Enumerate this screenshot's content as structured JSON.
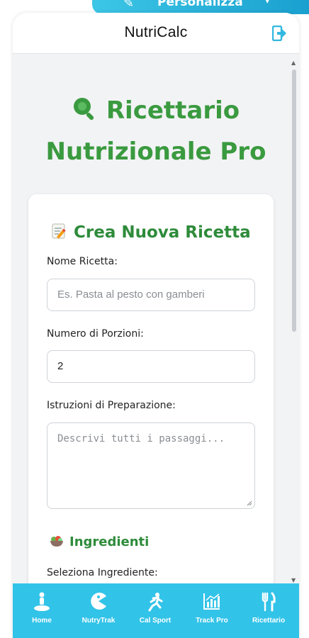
{
  "banner": {
    "label": "Personalizza"
  },
  "app": {
    "title": "NutriCalc"
  },
  "hero": {
    "line1": "Ricettario",
    "line2": "Nutrizionale Pro"
  },
  "form": {
    "title": "Crea Nuova Ricetta",
    "name_label": "Nome Ricetta:",
    "name_placeholder": "Es. Pasta al pesto con gamberi",
    "portions_label": "Numero di Porzioni:",
    "portions_value": "2",
    "instructions_label": "Istruzioni di Preparazione:",
    "instructions_placeholder": "Descrivi tutti i passaggi...",
    "ingredients_title": "Ingredienti",
    "select_label": "Seleziona Ingrediente:"
  },
  "nav": [
    {
      "label": "Home",
      "icon": "person-on-scale-icon"
    },
    {
      "label": "NutryTrak",
      "icon": "pacman-icon"
    },
    {
      "label": "Cal Sport",
      "icon": "runner-icon"
    },
    {
      "label": "Track Pro",
      "icon": "chart-icon"
    },
    {
      "label": "Ricettario",
      "icon": "utensils-icon"
    }
  ],
  "colors": {
    "accent_green": "#3a9a3f",
    "nav_blue": "#32c3e8",
    "background": "#f2f3f5"
  }
}
